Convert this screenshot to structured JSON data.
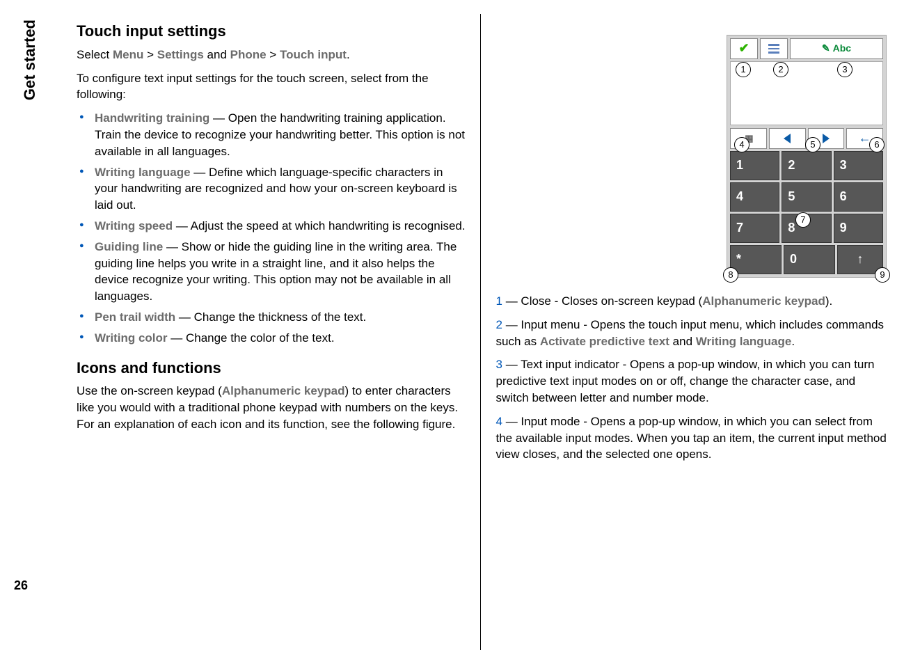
{
  "sidebar": {
    "label": "Get started"
  },
  "pageNumber": "26",
  "left": {
    "heading1": "Touch input settings",
    "select_prefix": "Select ",
    "nav": {
      "menu": "Menu",
      "gt1": " > ",
      "settings": "Settings",
      "and": " and ",
      "phone": "Phone",
      "gt2": " > ",
      "touch_input": "Touch input",
      "period": "."
    },
    "intro": "To configure text input settings for the touch screen, select from the following:",
    "items": [
      {
        "term": "Handwriting training",
        "desc": "  — Open the handwriting training application. Train the device to recognize your handwriting better. This option is not available in all languages."
      },
      {
        "term": "Writing language",
        "desc": "  — Define which language-specific characters in your handwriting are recognized and how your on-screen keyboard is laid out."
      },
      {
        "term": "Writing speed",
        "desc": "  — Adjust the speed at which handwriting is recognised."
      },
      {
        "term": "Guiding line",
        "desc": "  — Show or hide the guiding line in the writing area. The guiding line helps you write in a straight line, and it also helps the device recognize your writing. This option may not be available in all languages."
      },
      {
        "term": "Pen trail width",
        "desc": "  — Change the thickness of the text."
      },
      {
        "term": "Writing color",
        "desc": "  — Change the color of the text."
      }
    ],
    "heading2": "Icons and functions",
    "icons_p1a": "Use the on-screen keypad (",
    "icons_term": "Alphanumeric keypad",
    "icons_p1b": ") to enter characters like you would with a traditional phone keypad with numbers on the keys. For an explanation of each icon and its function, see the following figure."
  },
  "right": {
    "fig": {
      "abc": "Abc",
      "circles": {
        "c1": "1",
        "c2": "2",
        "c3": "3",
        "c4": "4",
        "c5": "5",
        "c6": "6",
        "c7": "7",
        "c8": "8",
        "c9": "9"
      },
      "keys": [
        "1",
        "2",
        "3",
        "4",
        "5",
        "6",
        "7",
        "8",
        "9",
        "*",
        "0",
        "↑"
      ]
    },
    "legend": [
      {
        "n": "1",
        "a": " — Close - Closes on-screen keypad (",
        "t": "Alphanumeric keypad",
        "b": ")."
      },
      {
        "n": "2",
        "a": " — Input menu - Opens the touch input menu, which includes commands such as ",
        "t": "Activate predictive text",
        "mid": " and ",
        "t2": "Writing language",
        "b": "."
      },
      {
        "n": "3",
        "a": " — Text input indicator - Opens a pop-up window, in which you can turn predictive text input modes on or off, change the character case, and switch between letter and number mode."
      },
      {
        "n": "4",
        "a": " — Input mode - Opens a pop-up window, in which you can select from the available input modes. When you tap an item, the current input method view closes, and the selected one opens."
      }
    ]
  }
}
